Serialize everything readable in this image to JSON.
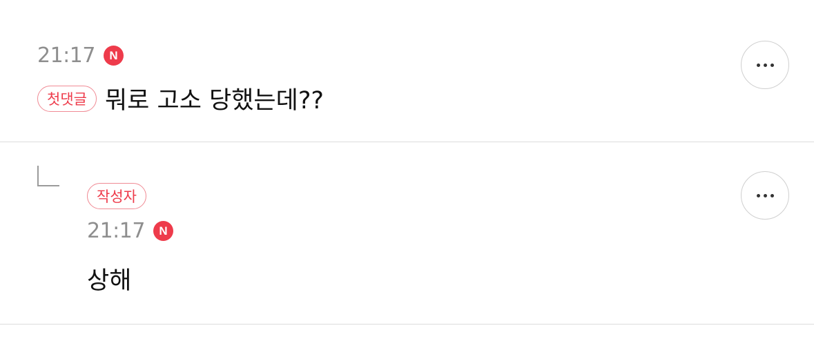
{
  "comments": [
    {
      "time": "21:17",
      "new_badge": "N",
      "tag": "첫댓글",
      "text": "뭐로 고소 당했는데??",
      "more_label": "more options"
    },
    {
      "tag": "작성자",
      "time": "21:17",
      "new_badge": "N",
      "text": "상해",
      "more_label": "more options",
      "is_reply": true
    }
  ],
  "colors": {
    "accent": "#ee3b4b",
    "time_gray": "#8e8e8e",
    "divider": "#dcdcdc"
  },
  "icons": {
    "more": "ellipsis-icon",
    "reply": "reply-arrow-icon",
    "new": "new-badge-icon"
  }
}
